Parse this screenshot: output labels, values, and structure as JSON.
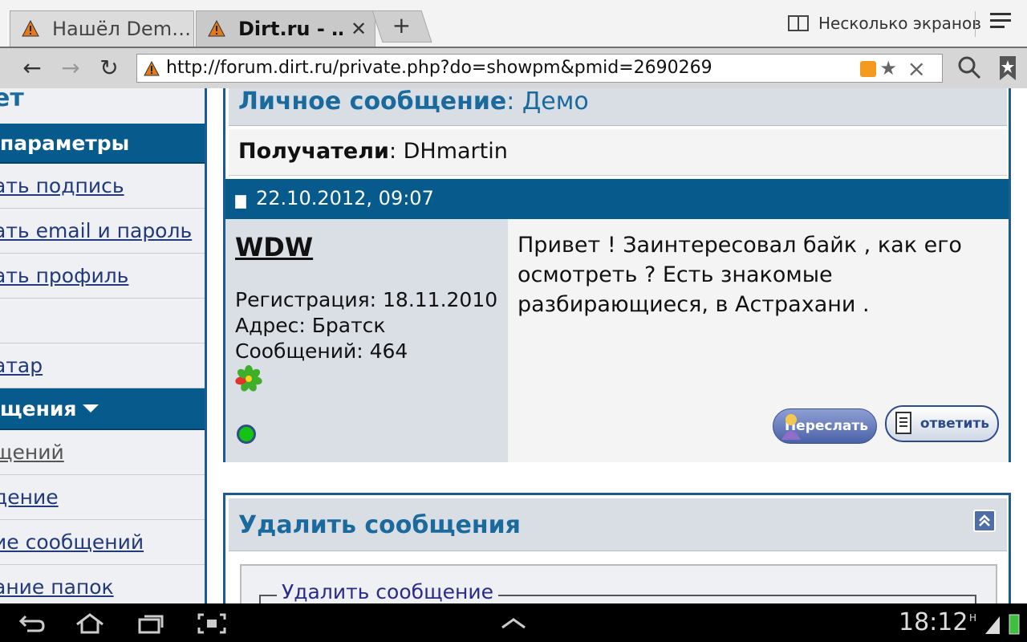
{
  "tabs": [
    {
      "title": "Нашёл Dem…",
      "active": false
    },
    {
      "title": "Dirt.ru - …",
      "active": true
    }
  ],
  "new_tab_label": "+",
  "multiscreen_label": "Несколько экранов",
  "url": "http://forum.dirt.ru/private.php?do=showpm&pmid=2690269",
  "sidebar": {
    "items": [
      {
        "label": "ет",
        "type": "title"
      },
      {
        "label": "параметры",
        "type": "header"
      },
      {
        "label": "ать подпись",
        "type": "link"
      },
      {
        "label": "ать email и пароль",
        "type": "link"
      },
      {
        "label": "ать профиль",
        "type": "link"
      },
      {
        "label": "",
        "type": "link"
      },
      {
        "label": "атар",
        "type": "link"
      },
      {
        "label": "щения",
        "type": "header"
      },
      {
        "label": "щений",
        "type": "visited"
      },
      {
        "label": "дение",
        "type": "link"
      },
      {
        "label": "ие сообщений",
        "type": "link"
      },
      {
        "label": "ание папок",
        "type": "link"
      }
    ]
  },
  "pm": {
    "title_bold": "Личное сообщение",
    "title_rest": ": Демо",
    "recipients_label": "Получатели",
    "recipients_value": ": DHmartin",
    "date": "22.10.2012, 09:07",
    "author": {
      "name": "WDW",
      "registration": "Регистрация: 18.11.2010",
      "address": "Адрес: Братск",
      "posts": "Сообщений: 464"
    },
    "message": "Привет ! Заинтересовал байк , как его осмотреть ? Есть знакомые разбирающиеся, в Астрахани .",
    "forward_label": "Переслать",
    "reply_label": "ответить"
  },
  "delete_section": {
    "title": "Удалить сообщения",
    "legend": "Удалить сообщение"
  },
  "status_bar": {
    "time": "18:12"
  },
  "colors": {
    "forum_blue": "#065a8c",
    "link": "#22397a",
    "panel_bg": "#d9dee5"
  }
}
